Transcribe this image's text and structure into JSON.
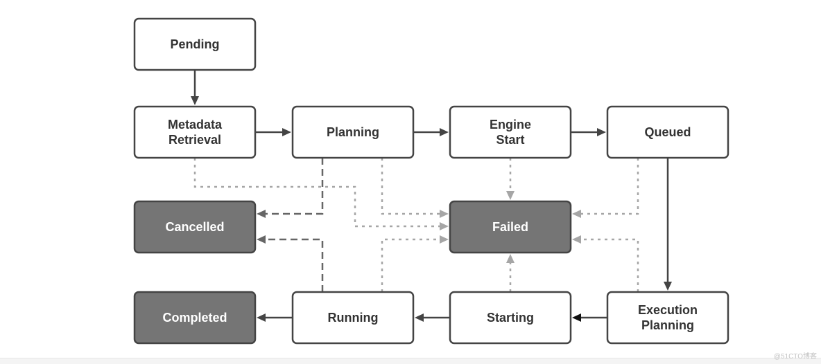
{
  "diagram": {
    "nodes": [
      {
        "id": "pending",
        "label": [
          "Pending"
        ],
        "style": "normal"
      },
      {
        "id": "metadata",
        "label": [
          "Metadata",
          "Retrieval"
        ],
        "style": "normal"
      },
      {
        "id": "planning",
        "label": [
          "Planning"
        ],
        "style": "normal"
      },
      {
        "id": "engine",
        "label": [
          "Engine",
          "Start"
        ],
        "style": "normal"
      },
      {
        "id": "queued",
        "label": [
          "Queued"
        ],
        "style": "normal"
      },
      {
        "id": "cancelled",
        "label": [
          "Cancelled"
        ],
        "style": "terminal"
      },
      {
        "id": "failed",
        "label": [
          "Failed"
        ],
        "style": "terminal"
      },
      {
        "id": "completed",
        "label": [
          "Completed"
        ],
        "style": "terminal"
      },
      {
        "id": "running",
        "label": [
          "Running"
        ],
        "style": "normal"
      },
      {
        "id": "starting",
        "label": [
          "Starting"
        ],
        "style": "normal"
      },
      {
        "id": "execplan",
        "label": [
          "Execution",
          "Planning"
        ],
        "style": "normal"
      }
    ],
    "edges": [
      {
        "from": "pending",
        "to": "metadata",
        "style": "solid"
      },
      {
        "from": "metadata",
        "to": "planning",
        "style": "solid"
      },
      {
        "from": "planning",
        "to": "engine",
        "style": "solid"
      },
      {
        "from": "engine",
        "to": "queued",
        "style": "solid"
      },
      {
        "from": "queued",
        "to": "execplan",
        "style": "solid"
      },
      {
        "from": "execplan",
        "to": "starting",
        "style": "solid"
      },
      {
        "from": "starting",
        "to": "running",
        "style": "solid"
      },
      {
        "from": "running",
        "to": "completed",
        "style": "solid"
      },
      {
        "from": "planning",
        "to": "cancelled",
        "style": "dashed"
      },
      {
        "from": "running",
        "to": "cancelled",
        "style": "dashed"
      },
      {
        "from": "metadata",
        "to": "failed",
        "style": "dotted"
      },
      {
        "from": "planning",
        "to": "failed",
        "style": "dotted"
      },
      {
        "from": "engine",
        "to": "failed",
        "style": "dotted"
      },
      {
        "from": "queued",
        "to": "failed",
        "style": "dotted"
      },
      {
        "from": "execplan",
        "to": "failed",
        "style": "dotted"
      },
      {
        "from": "starting",
        "to": "failed",
        "style": "dotted"
      },
      {
        "from": "running",
        "to": "failed",
        "style": "dotted"
      }
    ],
    "colors": {
      "border": "#444444",
      "terminal_fill": "#757575",
      "normal_fill": "#ffffff",
      "solid": "#444444",
      "dashed": "#666666",
      "dotted": "#a6a6a6",
      "text_dark": "#333333",
      "text_light": "#ffffff"
    }
  },
  "watermark": "@51CTO博客"
}
